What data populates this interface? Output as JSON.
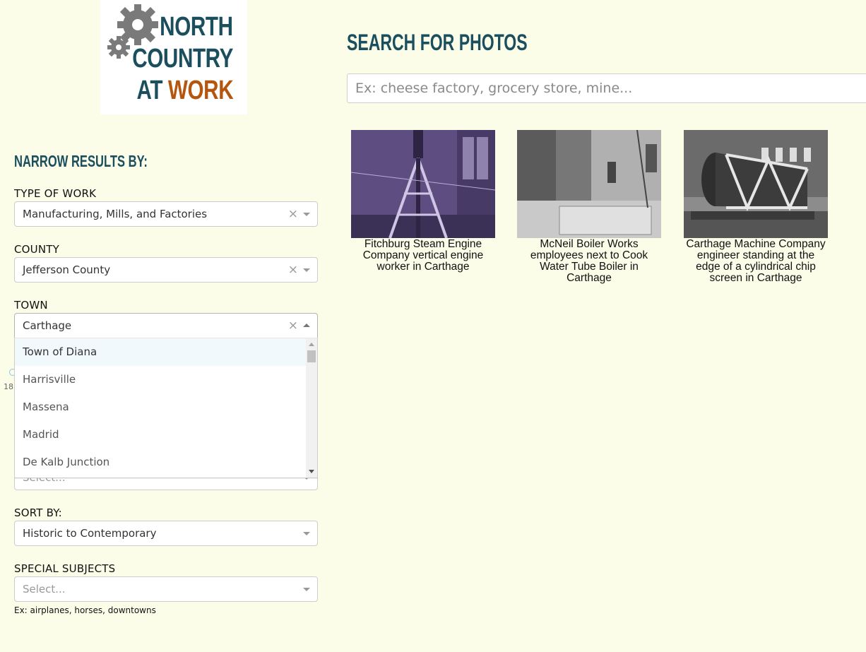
{
  "logo": {
    "line1": "NORTH",
    "line2": "COUNTRY",
    "line3_prefix": "AT ",
    "line3_accent": "WORK",
    "colors": {
      "primary": "#1b4f5e",
      "accent": "#b5560f",
      "gear": "#7a7a7a"
    }
  },
  "search": {
    "heading": "SEARCH FOR PHOTOS",
    "placeholder": "Ex: cheese factory, grocery store, mine..."
  },
  "filters": {
    "heading": "NARROW RESULTS BY:",
    "type_of_work": {
      "label": "TYPE OF WORK",
      "value": "Manufacturing, Mills, and Factories"
    },
    "county": {
      "label": "COUNTY",
      "value": "Jefferson County"
    },
    "town": {
      "label": "TOWN",
      "value": "Carthage",
      "options": [
        "Town of Diana",
        "Harrisville",
        "Massena",
        "Madrid",
        "De Kalb Junction"
      ]
    },
    "hidden": {
      "fragment_text": "18",
      "placeholder": "Select..."
    },
    "sort_by": {
      "label": "SORT BY:",
      "value": "Historic to Contemporary"
    },
    "special_subjects": {
      "label": "SPECIAL SUBJECTS",
      "placeholder": "Select...",
      "hint": "Ex: airplanes, horses, downtowns"
    }
  },
  "icons": {
    "clear": "clear-x-icon",
    "dropdown": "chevron-down-icon",
    "dropdown_open": "chevron-up-icon",
    "logo_gears": "gears-icon"
  },
  "results": [
    {
      "caption": "Fitchburg Steam Engine Company vertical engine worker in Carthage",
      "tint": "#6a5a8a"
    },
    {
      "caption": "McNeil Boiler Works employees next to Cook Water Tube Boiler in Carthage",
      "tint": "#8a8a8a"
    },
    {
      "caption": "Carthage Machine Company engineer standing at the edge of a cylindrical chip screen in Carthage",
      "tint": "#6e6e6e"
    }
  ]
}
